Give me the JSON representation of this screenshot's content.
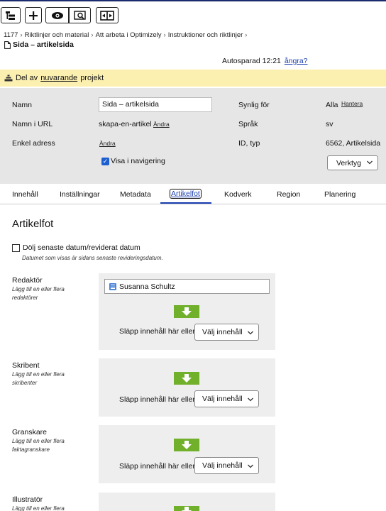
{
  "toolbar": {
    "icons": [
      "navigation-tree-icon",
      "add-icon",
      "view-icon",
      "preview-icon",
      "compare-icon"
    ]
  },
  "breadcrumb": {
    "items": [
      "1177",
      "Riktlinjer och material",
      "Att arbeta i Optimizely",
      "Instruktioner och riktlinjer"
    ]
  },
  "page": {
    "title": "Sida – artikelsida"
  },
  "autosave": {
    "text": "Autosparad 12:21",
    "undo_label": "ångra?"
  },
  "banner": {
    "prefix": "Del av",
    "link": "nuvarande",
    "suffix": "projekt"
  },
  "props": {
    "name_label": "Namn",
    "name_value": "Sida – artikelsida",
    "url_label": "Namn i URL",
    "url_value": "skapa-en-artikel",
    "url_change": "Ändra",
    "simple_label": "Enkel adress",
    "simple_change": "Ändra",
    "nav_checkbox": "Visa i navigering",
    "visible_label": "Synlig för",
    "visible_value": "Alla",
    "visible_manage": "Hantera",
    "lang_label": "Språk",
    "lang_value": "sv",
    "id_label": "ID, typ",
    "id_value": "6562, Artikelsida",
    "tools_label": "Verktyg"
  },
  "tabs": [
    "Innehåll",
    "Inställningar",
    "Metadata",
    "Artikelfot",
    "Kodverk",
    "Region",
    "Planering"
  ],
  "content": {
    "title": "Artikelfot",
    "hide_date_label": "Dölj senaste datum/reviderat datum",
    "hide_date_help": "Datumet som visas är sidans senaste revideringsdatum."
  },
  "fields": [
    {
      "label": "Redaktör",
      "help": "Lägg till en eller flera redaktörer",
      "item": "Susanna Schultz",
      "drop_text": "Släpp innehåll här eller",
      "choose": "Välj innehåll"
    },
    {
      "label": "Skribent",
      "help": "Lägg till en eller flera skribenter",
      "drop_text": "Släpp innehåll här eller",
      "choose": "Välj innehåll"
    },
    {
      "label": "Granskare",
      "help": "Lägg till en eller flera faktagranskare",
      "drop_text": "Släpp innehåll här eller",
      "choose": "Välj innehåll"
    },
    {
      "label": "Illustratör",
      "help": "Lägg till en eller flera"
    }
  ],
  "colors": {
    "banner": "#fcf0b0",
    "panel": "#e6e6e6",
    "link": "#1b3fb0",
    "drop_arrow": "#70b02a"
  }
}
